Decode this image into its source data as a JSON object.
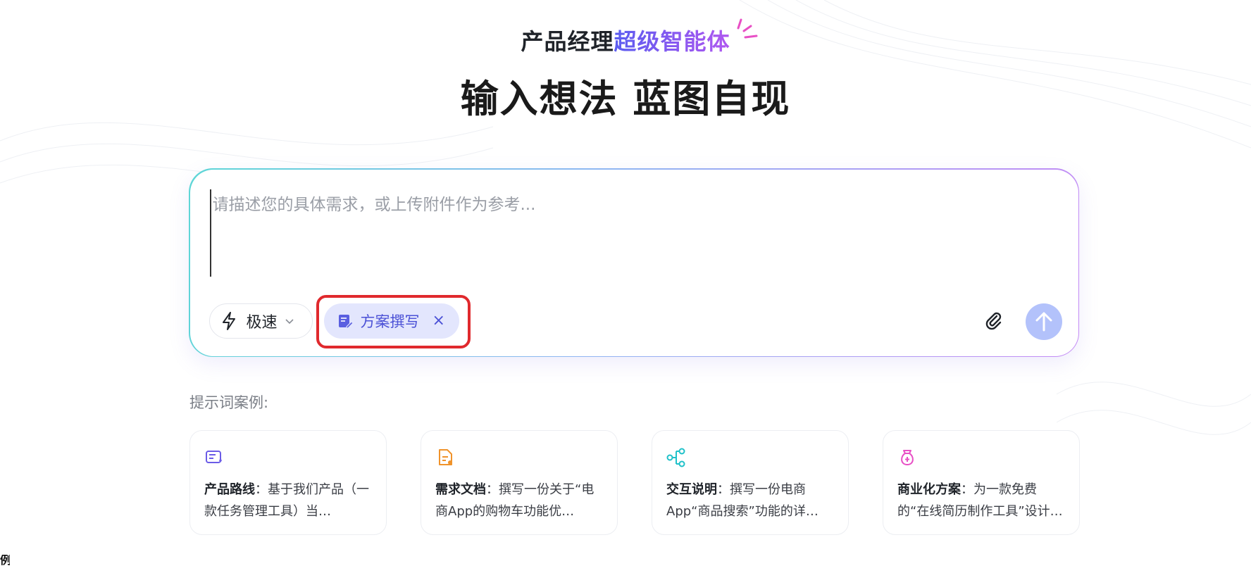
{
  "header": {
    "subtitle_prefix": "产品经理",
    "subtitle_accent": "超级智能体",
    "title": "输入想法 蓝图自现"
  },
  "composer": {
    "placeholder": "请描述您的具体需求，或上传附件作为参考...",
    "mode_label": "极速",
    "tag_label": "方案撰写",
    "tag_close": "×",
    "highlight_color": "#e0292d"
  },
  "examples": {
    "title": "提示词案例:",
    "items": [
      {
        "icon": "roadmap-icon",
        "color": "#6b5ce7",
        "bold": "产品路线",
        "text": "：基于我们产品（一款任务管理工具）当…"
      },
      {
        "icon": "requirement-doc-icon",
        "color": "#f0932b",
        "bold": "需求文档",
        "text": "：撰写一份关于“电商App的购物车功能优…"
      },
      {
        "icon": "interaction-flow-icon",
        "color": "#1fc1c9",
        "bold": "交互说明",
        "text": "：撰写一份电商App“商品搜索”功能的详…"
      },
      {
        "icon": "monetization-icon",
        "color": "#e84fc5",
        "bold": "商业化方案",
        "text": "：为一款免费的“在线简历制作工具”设计…"
      }
    ]
  },
  "corner_glyph": "例"
}
